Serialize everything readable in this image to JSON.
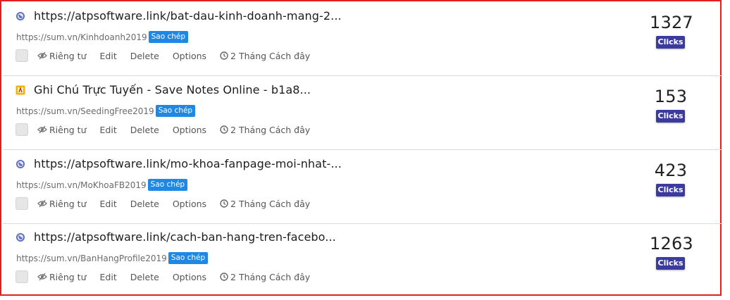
{
  "links": [
    {
      "icon": "globe-icon",
      "title": "https://atpsoftware.link/bat-dau-kinh-doanh-mang-2...",
      "short_url": "https://sum.vn/Kinhdoanh2019",
      "copy_label": "Sao chép",
      "private_label": "Riêng tư",
      "edit_label": "Edit",
      "delete_label": "Delete",
      "options_label": "Options",
      "time_label": "2 Tháng Cách đây",
      "count": "1327",
      "clicks_label": "Clicks"
    },
    {
      "icon": "notes-app-icon",
      "title": "Ghi Chú Trực Tuyến - Save Notes Online - b1a8...",
      "short_url": "https://sum.vn/SeedingFree2019",
      "copy_label": "Sao chép",
      "private_label": "Riêng tư",
      "edit_label": "Edit",
      "delete_label": "Delete",
      "options_label": "Options",
      "time_label": "2 Tháng Cách đây",
      "count": "153",
      "clicks_label": "Clicks"
    },
    {
      "icon": "globe-icon",
      "title": "https://atpsoftware.link/mo-khoa-fanpage-moi-nhat-...",
      "short_url": "https://sum.vn/MoKhoaFB2019",
      "copy_label": "Sao chép",
      "private_label": "Riêng tư",
      "edit_label": "Edit",
      "delete_label": "Delete",
      "options_label": "Options",
      "time_label": "2 Tháng Cách đây",
      "count": "423",
      "clicks_label": "Clicks"
    },
    {
      "icon": "globe-icon",
      "title": "https://atpsoftware.link/cach-ban-hang-tren-facebo...",
      "short_url": "https://sum.vn/BanHangProfile2019",
      "copy_label": "Sao chép",
      "private_label": "Riêng tư",
      "edit_label": "Edit",
      "delete_label": "Delete",
      "options_label": "Options",
      "time_label": "2 Tháng Cách đây",
      "count": "1263",
      "clicks_label": "Clicks"
    }
  ],
  "colors": {
    "copy_badge": "#1e88e5",
    "clicks_badge": "#3a3aa0",
    "frame_border": "#e02020"
  }
}
